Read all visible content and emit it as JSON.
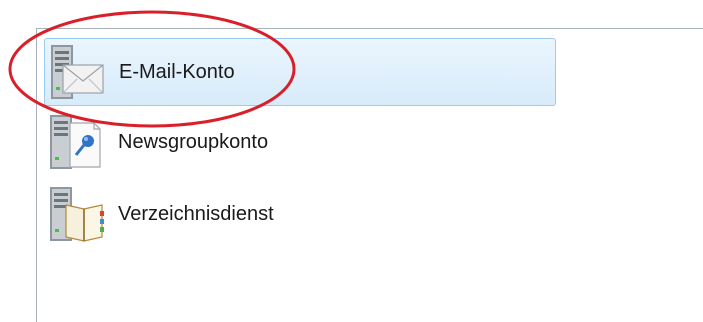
{
  "accounts": {
    "items": [
      {
        "label": "E-Mail-Konto",
        "icon": "email-account-icon",
        "selected": true
      },
      {
        "label": "Newsgroupkonto",
        "icon": "newsgroup-account-icon",
        "selected": false
      },
      {
        "label": "Verzeichnisdienst",
        "icon": "directory-service-icon",
        "selected": false
      }
    ]
  },
  "colors": {
    "selection_fill": "#dcecfc",
    "selection_border": "#9ccbf0",
    "annotation_ellipse": "#d9202a"
  }
}
